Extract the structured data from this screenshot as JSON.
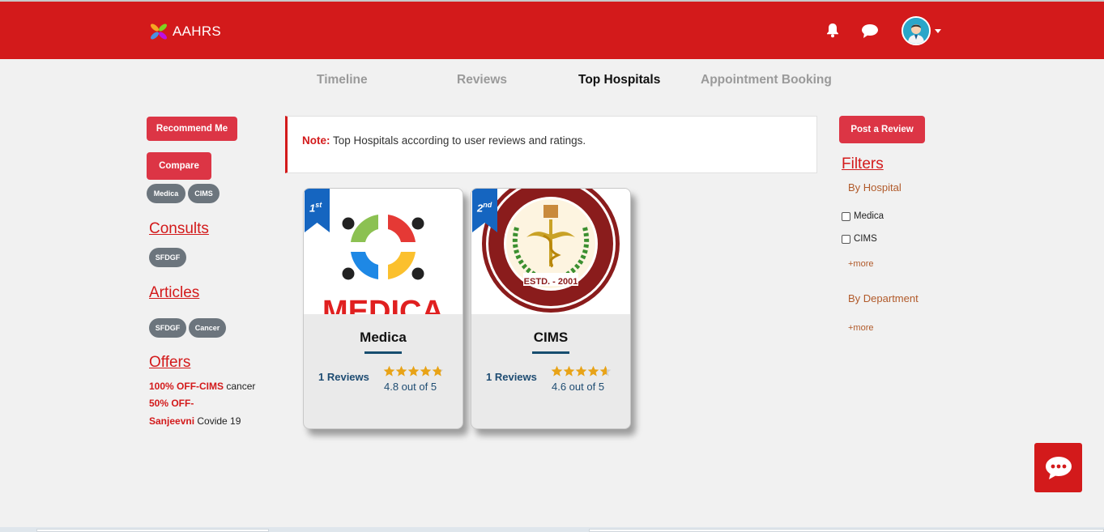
{
  "header": {
    "brand": "AAHRS",
    "icons": [
      "bell-icon",
      "chat-icon",
      "avatar-icon",
      "caret-down-icon"
    ]
  },
  "tabs": [
    {
      "label": "Timeline",
      "active": false
    },
    {
      "label": "Reviews",
      "active": false
    },
    {
      "label": "Top Hospitals",
      "active": true
    },
    {
      "label": "Appointment Booking",
      "active": false
    }
  ],
  "left": {
    "recommend_label": "Recommend Me",
    "compare_label": "Compare",
    "compare_tags": [
      "Medica",
      "CIMS"
    ],
    "consults_title": "Consults",
    "consults_tags": [
      "SFDGF"
    ],
    "articles_title": "Articles",
    "articles_tags": [
      "SFDGF",
      "Cancer"
    ],
    "offers_title": "Offers",
    "offers": [
      {
        "highlight": "100% OFF-CIMS",
        "text": " cancer"
      },
      {
        "highlight": "50% OFF-",
        "text": ""
      },
      {
        "highlight": "Sanjeevni",
        "text": " Covide 19"
      }
    ]
  },
  "note": {
    "label": "Note:",
    "text": " Top Hospitals according to user reviews and ratings."
  },
  "hospitals": [
    {
      "rank": "1",
      "rank_suffix": "st",
      "name": "Medica",
      "logo_text": "MEDICA",
      "reviews": "1 Reviews",
      "rating_text": "4.8 out of 5",
      "rating": 4.8
    },
    {
      "rank": "2",
      "rank_suffix": "nd",
      "name": "CIMS",
      "logo_text": "ESTD. - 2001",
      "reviews": "1 Reviews",
      "rating_text": "4.6 out of 5",
      "rating": 4.6
    }
  ],
  "right": {
    "post_review_label": "Post a Review",
    "filters_title": "Filters",
    "by_hospital": "By Hospital",
    "hospital_options": [
      "Medica",
      "CIMS"
    ],
    "more1": "+more",
    "by_department": "By Department",
    "more2": "+more"
  },
  "colors": {
    "brand_red": "#d31a1b",
    "button_red": "#dc3545",
    "pill_gray": "#6c757d",
    "ribbon_blue": "#1565c0",
    "star_gold": "#e8a317",
    "text_navy": "#1e4c72"
  }
}
